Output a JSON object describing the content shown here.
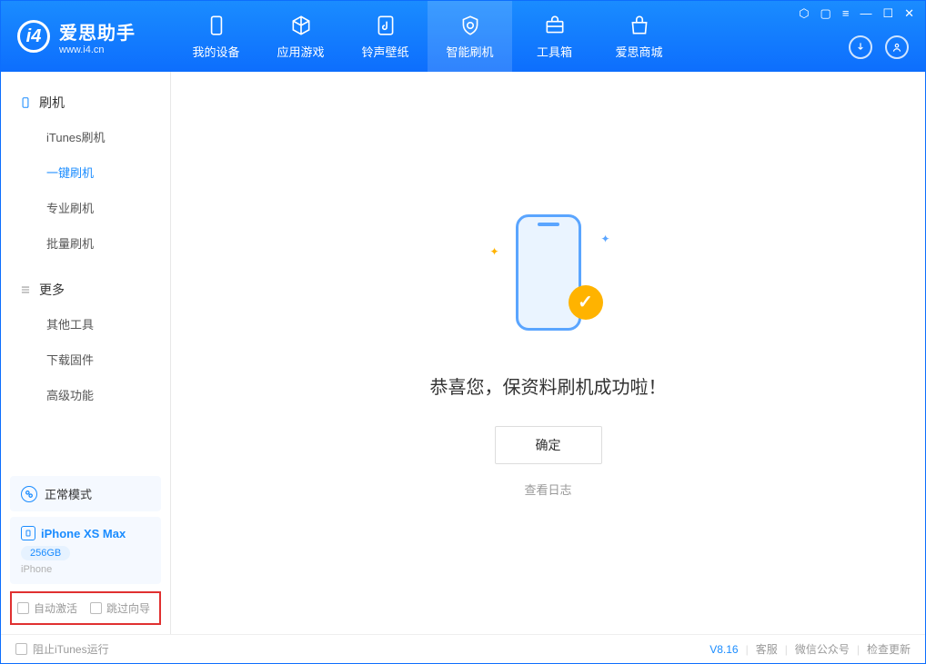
{
  "app": {
    "title": "爱思助手",
    "subtitle": "www.i4.cn"
  },
  "nav": {
    "tabs": [
      {
        "label": "我的设备"
      },
      {
        "label": "应用游戏"
      },
      {
        "label": "铃声壁纸"
      },
      {
        "label": "智能刷机"
      },
      {
        "label": "工具箱"
      },
      {
        "label": "爱思商城"
      }
    ]
  },
  "sidebar": {
    "group_flash": "刷机",
    "items_flash": [
      {
        "label": "iTunes刷机"
      },
      {
        "label": "一键刷机"
      },
      {
        "label": "专业刷机"
      },
      {
        "label": "批量刷机"
      }
    ],
    "group_more": "更多",
    "items_more": [
      {
        "label": "其他工具"
      },
      {
        "label": "下载固件"
      },
      {
        "label": "高级功能"
      }
    ],
    "mode_label": "正常模式",
    "device": {
      "name": "iPhone XS Max",
      "storage": "256GB",
      "type": "iPhone"
    },
    "checkboxes": {
      "auto_activate": "自动激活",
      "skip_guide": "跳过向导"
    }
  },
  "main": {
    "success_text": "恭喜您，保资料刷机成功啦！",
    "ok_label": "确定",
    "log_link": "查看日志"
  },
  "footer": {
    "block_itunes": "阻止iTunes运行",
    "version": "V8.16",
    "links": {
      "service": "客服",
      "wechat": "微信公众号",
      "update": "检查更新"
    }
  }
}
